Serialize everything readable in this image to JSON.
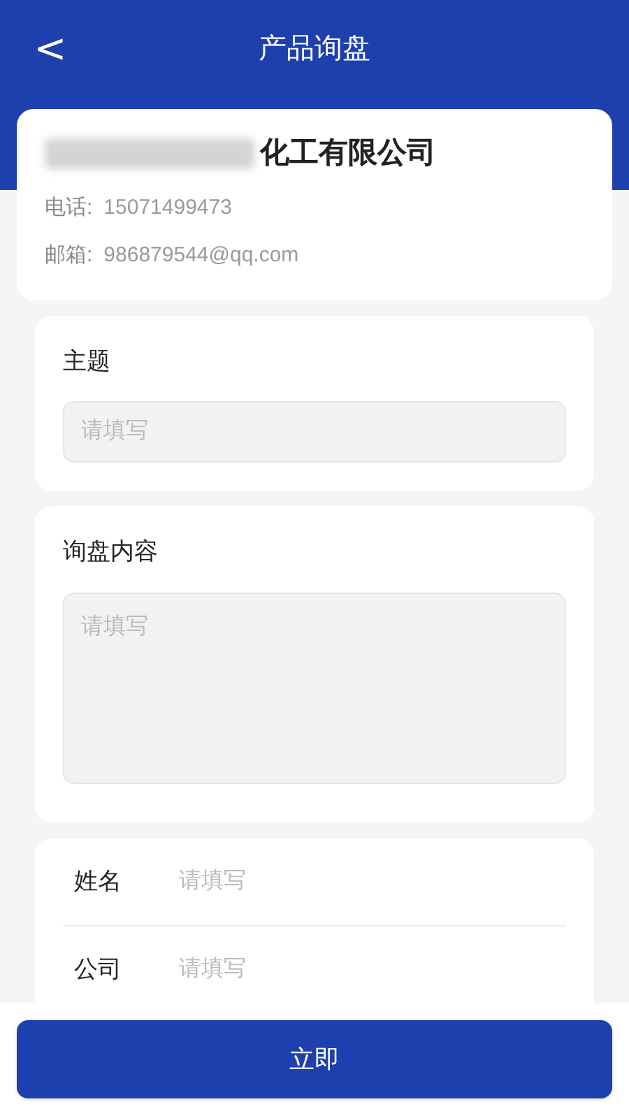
{
  "header": {
    "back": "<",
    "title": "产品询盘"
  },
  "company": {
    "name": "化工有限公司",
    "phone_label": "电话:",
    "phone": "15071499473",
    "email_label": "邮箱:",
    "email": "986879544@qq.com"
  },
  "subject": {
    "label": "主题",
    "placeholder": "请填写"
  },
  "content": {
    "label": "询盘内容",
    "placeholder": "请填写"
  },
  "contact_fields": [
    {
      "label": "姓名",
      "placeholder": "请填写"
    },
    {
      "label": "公司",
      "placeholder": "请填写"
    }
  ],
  "submit": {
    "label": "立即"
  }
}
